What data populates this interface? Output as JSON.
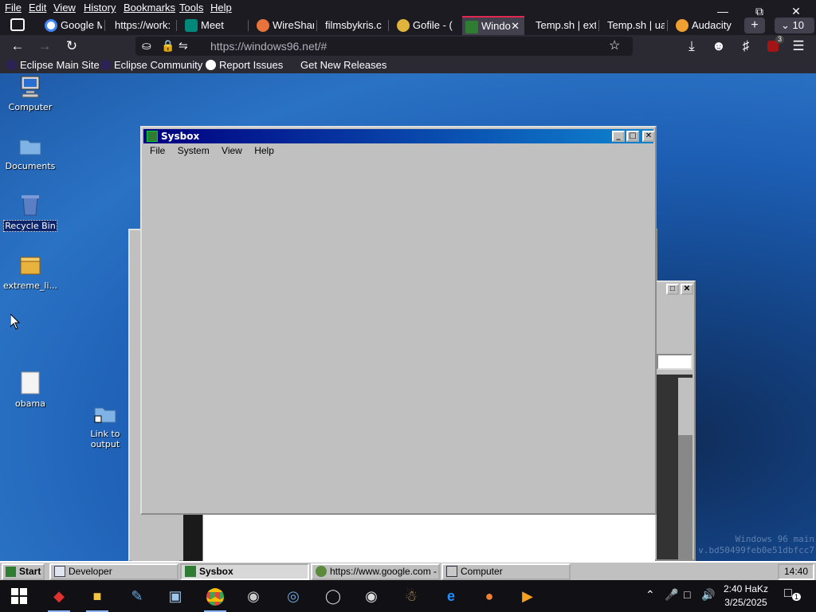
{
  "browser": {
    "menu": [
      "File",
      "Edit",
      "View",
      "History",
      "Bookmarks",
      "Tools",
      "Help"
    ],
    "tabs": [
      {
        "label": "Google M",
        "color": "#ffffff",
        "active": false
      },
      {
        "label": "https://work:",
        "color": "#888888",
        "active": false
      },
      {
        "label": "Meet",
        "color": "#00897b",
        "active": false
      },
      {
        "label": "WireShar",
        "color": "#e8743b",
        "active": false
      },
      {
        "label": "filmsbykris.c",
        "color": "#888888",
        "active": false
      },
      {
        "label": "Gofile - (",
        "color": "#e0b43a",
        "active": false
      },
      {
        "label": "Windo",
        "color": "#2f7d32",
        "active": true
      },
      {
        "label": "Temp.sh | ext",
        "color": "#888888",
        "active": false
      },
      {
        "label": "Temp.sh | ua",
        "color": "#888888",
        "active": false
      },
      {
        "label": "Audacity",
        "color": "#f0a030",
        "active": false
      }
    ],
    "tab_overflow_count": "10",
    "url": "https://windows96.net/#",
    "extension_badge": "3",
    "bookmarks": [
      {
        "label": "Eclipse Main Site",
        "color": "#2c2255"
      },
      {
        "label": "Eclipse Community",
        "color": "#2c2255"
      },
      {
        "label": "Report Issues",
        "color": "#ffffff"
      },
      {
        "label": "Get New Releases",
        "color": ""
      }
    ]
  },
  "desktop": {
    "icons": [
      {
        "label": "Computer",
        "icon": "computer-icon"
      },
      {
        "label": "Documents",
        "icon": "folder-icon"
      },
      {
        "label": "Recycle Bin",
        "icon": "recycle-bin-icon"
      },
      {
        "label": "extreme_li...",
        "icon": "archive-icon"
      },
      {
        "label": "obama",
        "icon": "file-icon"
      },
      {
        "label": "Link to output",
        "icon": "folder-link-icon"
      }
    ],
    "watermark_line1": "Windows 96 main",
    "watermark_line2": "v.bd50499feb0e51dbfcc7"
  },
  "sysbox": {
    "title": "Sysbox",
    "menu": [
      "File",
      "System",
      "View",
      "Help"
    ]
  },
  "w96_taskbar": {
    "start": "Start",
    "items": [
      {
        "label": "Developer",
        "pressed": false
      },
      {
        "label": "Sysbox",
        "pressed": true
      },
      {
        "label": "https://www.google.com - I...",
        "pressed": false
      },
      {
        "label": "Computer",
        "pressed": false
      }
    ],
    "clock": "14:40"
  },
  "host_taskbar": {
    "time": "2:40 HaKz",
    "date": "3/25/2025",
    "notification_count": "1"
  }
}
